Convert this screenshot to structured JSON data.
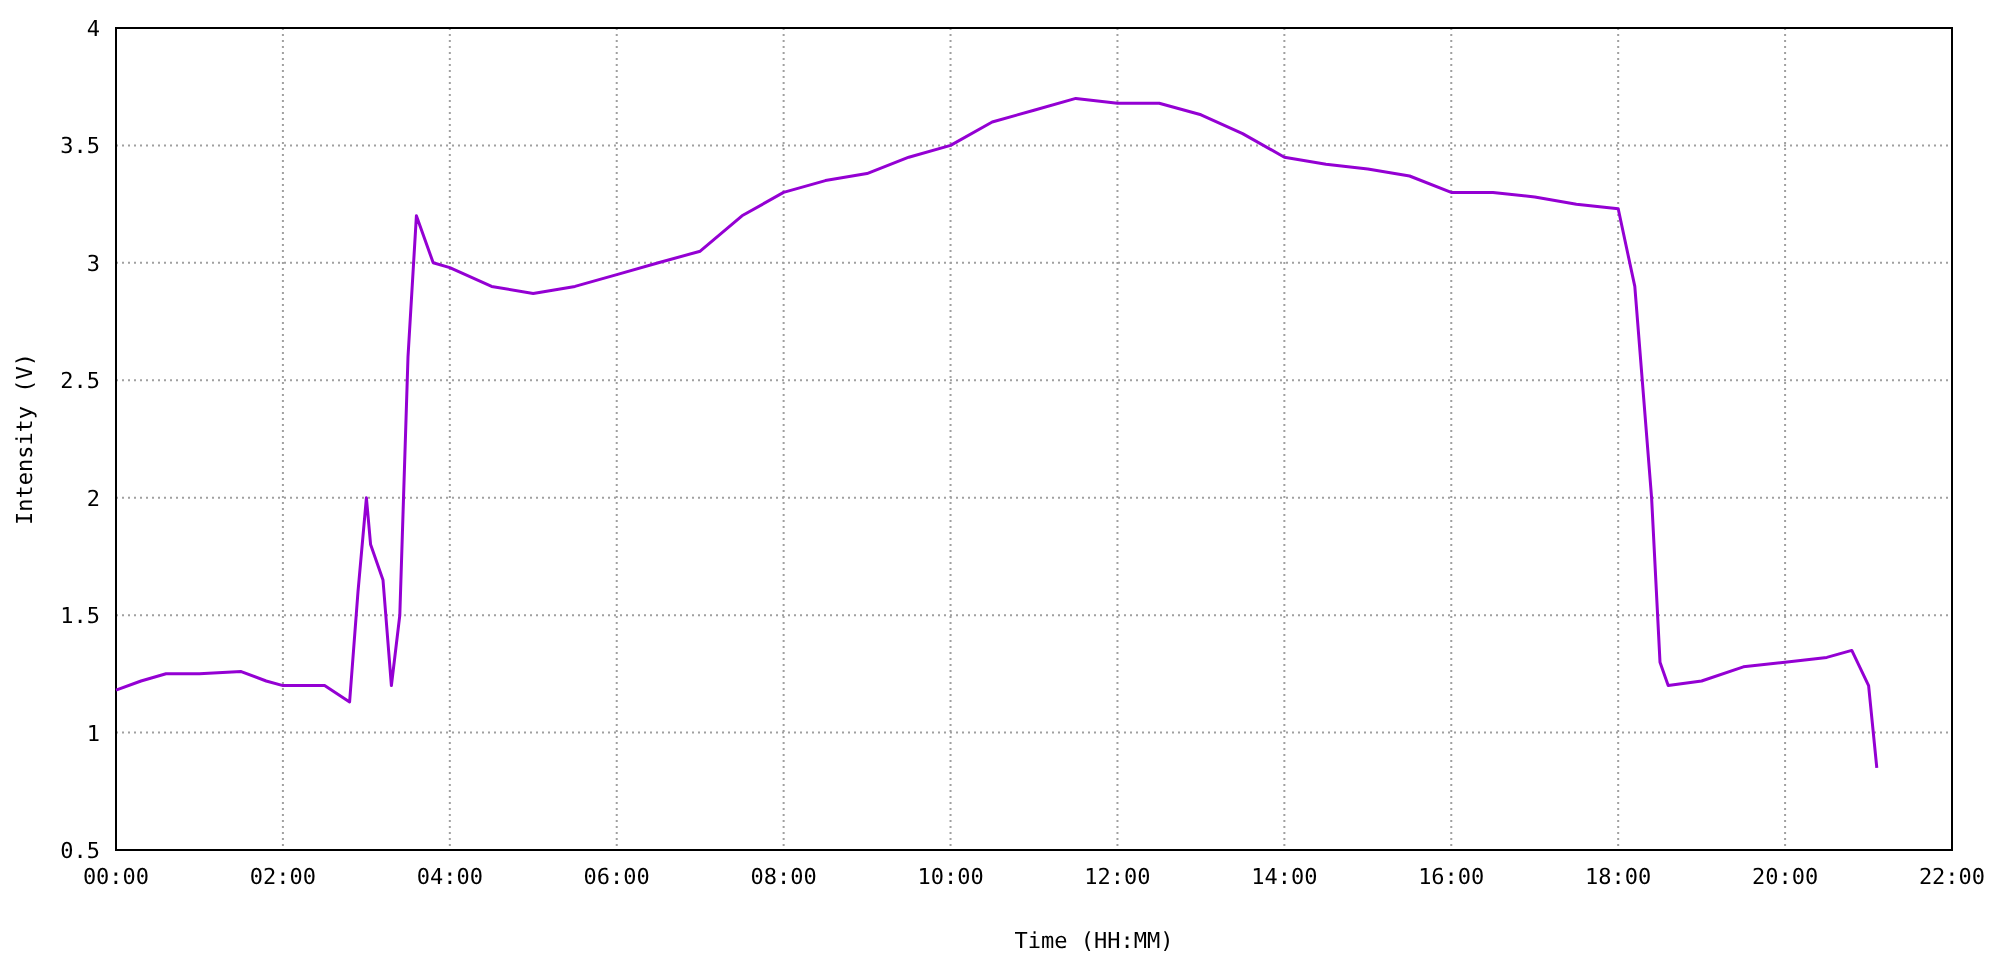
{
  "chart_data": {
    "type": "line",
    "xlabel": "Time (HH:MM)",
    "ylabel": "Intensity (V)",
    "x": [
      0,
      0.3,
      0.6,
      1.0,
      1.5,
      1.8,
      2.0,
      2.5,
      2.8,
      2.9,
      3.0,
      3.05,
      3.2,
      3.3,
      3.4,
      3.5,
      3.6,
      3.8,
      4.0,
      4.5,
      5.0,
      5.5,
      6.0,
      6.5,
      7.0,
      7.5,
      8.0,
      8.5,
      9.0,
      9.5,
      10.0,
      10.5,
      11.0,
      11.5,
      12.0,
      12.5,
      13.0,
      13.5,
      14.0,
      14.5,
      15.0,
      15.5,
      16.0,
      16.5,
      17.0,
      17.5,
      18.0,
      18.2,
      18.4,
      18.5,
      18.6,
      19.0,
      19.5,
      20.0,
      20.5,
      20.8,
      21.0,
      21.1
    ],
    "grid": true,
    "series": [
      {
        "color": "#9400d3",
        "values": [
          1.18,
          1.22,
          1.25,
          1.25,
          1.26,
          1.22,
          1.2,
          1.2,
          1.13,
          1.6,
          2.0,
          1.8,
          1.65,
          1.2,
          1.5,
          2.6,
          3.2,
          3.0,
          2.98,
          2.9,
          2.87,
          2.9,
          2.95,
          3.0,
          3.05,
          3.2,
          3.3,
          3.35,
          3.38,
          3.45,
          3.5,
          3.6,
          3.65,
          3.7,
          3.68,
          3.68,
          3.63,
          3.55,
          3.45,
          3.42,
          3.4,
          3.37,
          3.3,
          3.3,
          3.28,
          3.25,
          3.23,
          2.9,
          2.0,
          1.3,
          1.2,
          1.22,
          1.28,
          1.3,
          1.32,
          1.35,
          1.2,
          0.85
        ]
      }
    ],
    "xlim": [
      0,
      22
    ],
    "ylim": [
      0.5,
      4
    ],
    "xticks": [
      {
        "value": 0,
        "label": "00:00"
      },
      {
        "value": 2,
        "label": "02:00"
      },
      {
        "value": 4,
        "label": "04:00"
      },
      {
        "value": 6,
        "label": "06:00"
      },
      {
        "value": 8,
        "label": "08:00"
      },
      {
        "value": 10,
        "label": "10:00"
      },
      {
        "value": 12,
        "label": "12:00"
      },
      {
        "value": 14,
        "label": "14:00"
      },
      {
        "value": 16,
        "label": "16:00"
      },
      {
        "value": 18,
        "label": "18:00"
      },
      {
        "value": 20,
        "label": "20:00"
      },
      {
        "value": 22,
        "label": "22:00"
      }
    ],
    "yticks": [
      {
        "value": 0.5,
        "label": "0.5"
      },
      {
        "value": 1,
        "label": "1"
      },
      {
        "value": 1.5,
        "label": "1.5"
      },
      {
        "value": 2,
        "label": "2"
      },
      {
        "value": 2.5,
        "label": "2.5"
      },
      {
        "value": 3,
        "label": "3"
      },
      {
        "value": 3.5,
        "label": "3.5"
      },
      {
        "value": 4,
        "label": "4"
      }
    ]
  }
}
